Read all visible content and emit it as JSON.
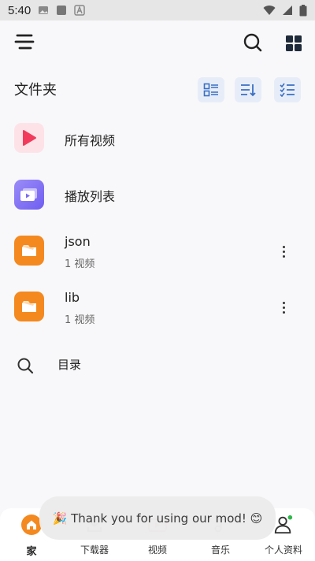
{
  "status_bar": {
    "time": "5:40",
    "left_icons": [
      "image-icon",
      "square-icon",
      "text-a-icon"
    ],
    "right_icons": [
      "wifi-icon",
      "signal-icon",
      "battery-icon"
    ]
  },
  "header": {
    "menu_icon": "menu-icon",
    "search_icon": "search-icon",
    "grid_icon": "grid-icon"
  },
  "folders_section": {
    "title": "文件夹",
    "view_buttons": [
      "list-view-icon",
      "sort-icon",
      "checklist-icon"
    ]
  },
  "items": [
    {
      "title": "所有视频",
      "subtitle": "",
      "icon": "play-icon",
      "color": "#f23b5c",
      "bg": "#fde3e8"
    },
    {
      "title": "播放列表",
      "subtitle": "",
      "icon": "playlist-icon",
      "color": "#7b6cf2",
      "bg": "#8c7cf6"
    },
    {
      "title": "json",
      "subtitle": "1 视频",
      "icon": "folder-icon",
      "color": "#f4891f",
      "bg": "#f4891f"
    },
    {
      "title": "lib",
      "subtitle": "1 视频",
      "icon": "folder-icon",
      "color": "#f4891f",
      "bg": "#f4891f"
    }
  ],
  "directory": {
    "label": "目录",
    "icon": "search-icon"
  },
  "bottom_nav": [
    {
      "label": "家",
      "icon": "home-icon",
      "active": true
    },
    {
      "label": "下载器",
      "icon": "download-icon",
      "active": false
    },
    {
      "label": "视频",
      "icon": "video-icon",
      "active": false
    },
    {
      "label": "音乐",
      "icon": "music-icon",
      "active": false
    },
    {
      "label": "个人资料",
      "icon": "profile-icon",
      "active": false
    }
  ],
  "toast": {
    "text": "🎉 Thank you for using our mod! 😊"
  },
  "colors": {
    "accent": "#f4891f",
    "view_button_bg": "#e7edf8",
    "view_button_icon": "#3a6fc4",
    "status_dot": "#2fb84a"
  }
}
